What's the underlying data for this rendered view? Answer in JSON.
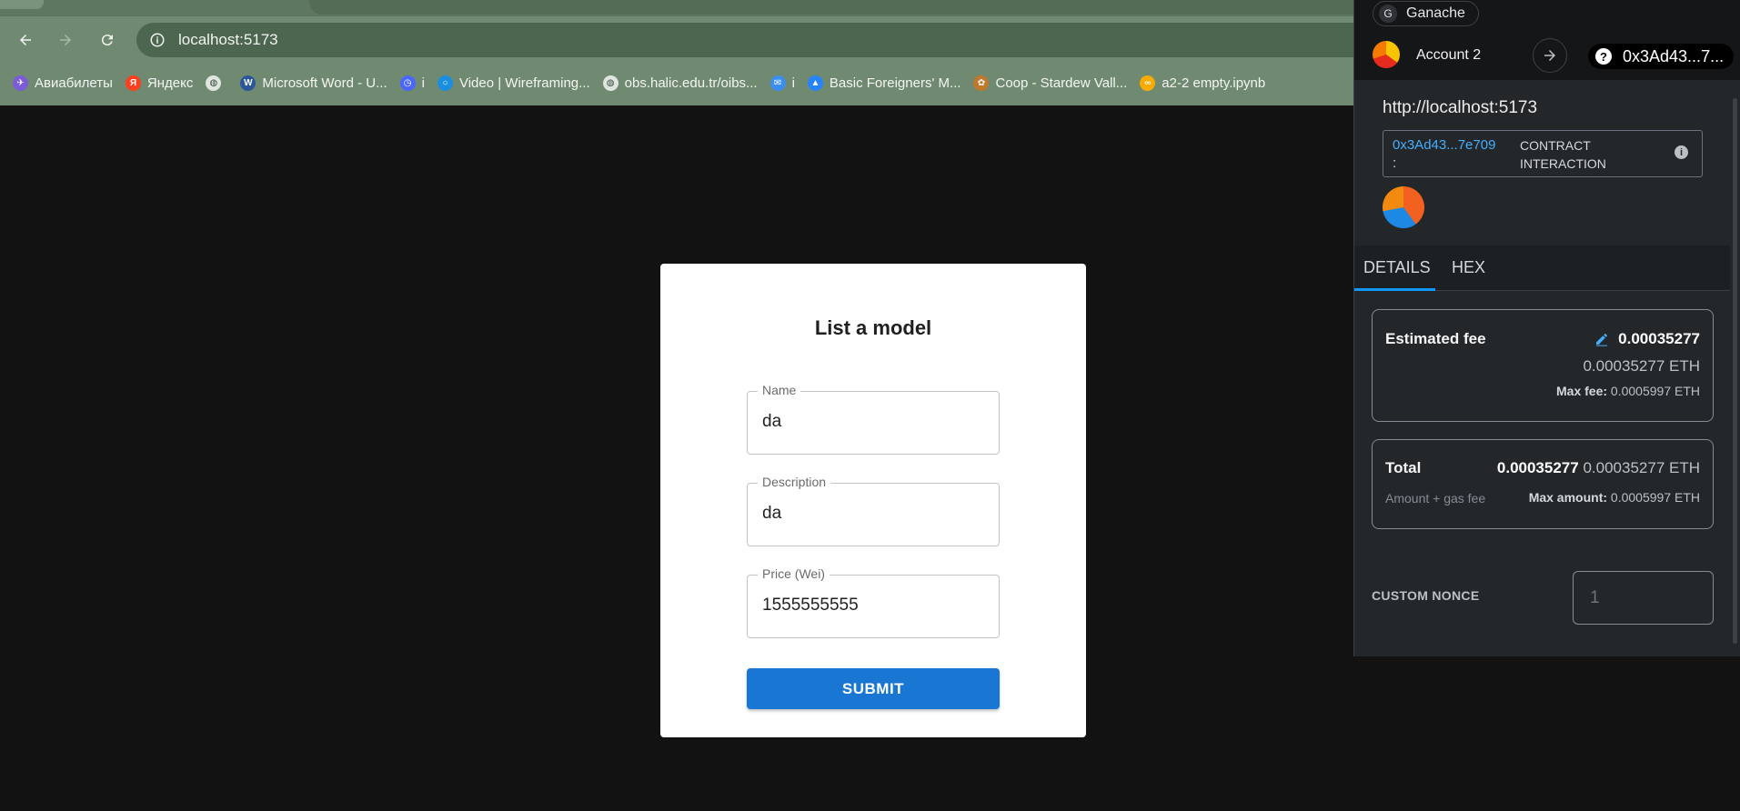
{
  "browser": {
    "url": "localhost:5173",
    "bookmarks": [
      {
        "label": "Авиабилеты",
        "icon": "airplane-globe-icon",
        "color": "#7b5cd6"
      },
      {
        "label": "Яндекс",
        "icon": "yandex-icon",
        "color": "#fc3f1d"
      },
      {
        "label": "",
        "icon": "globe-icon",
        "color": "#dfe5df"
      },
      {
        "label": "Microsoft Word - U...",
        "icon": "word-doc-icon",
        "color": "#2b579a"
      },
      {
        "label": "i",
        "icon": "time-tracker-icon",
        "color": "#4a66ff"
      },
      {
        "label": "Video | Wireframing...",
        "icon": "circle-icon",
        "color": "#1a8fe0"
      },
      {
        "label": "obs.halic.edu.tr/oibs...",
        "icon": "globe-icon",
        "color": "#dfe5df"
      },
      {
        "label": "i",
        "icon": "mail-icon",
        "color": "#3b8ef0"
      },
      {
        "label": "Basic Foreigners' M...",
        "icon": "atlassian-icon",
        "color": "#2684ff"
      },
      {
        "label": "Coop - Stardew Vall...",
        "icon": "stardew-icon",
        "color": "#c0792a"
      },
      {
        "label": "a2-2 empty.ipynb",
        "icon": "colab-icon",
        "color": "#f9ab00"
      }
    ]
  },
  "form": {
    "title": "List a model",
    "fields": [
      {
        "label": "Name",
        "value": "da"
      },
      {
        "label": "Description",
        "value": "da"
      },
      {
        "label": "Price (Wei)",
        "value": "1555555555"
      }
    ],
    "submit_label": "SUBMIT"
  },
  "metamask": {
    "network": "Ganache",
    "network_initial": "G",
    "account_name": "Account 2",
    "to_address": "0x3Ad43...7...",
    "origin": "http://localhost:5173",
    "contract_address": "0x3Ad43...7e709",
    "contract_colon": ":",
    "interaction_line1": "CONTRACT",
    "interaction_line2": "INTERACTION",
    "tabs": [
      "DETAILS",
      "HEX"
    ],
    "fee": {
      "label": "Estimated fee",
      "value": "0.00035277",
      "value_eth": "0.00035277 ETH",
      "max_label": "Max fee:",
      "max_value": "0.0005997 ETH"
    },
    "total": {
      "label": "Total",
      "value": "0.00035277",
      "value_eth": "0.00035277 ETH",
      "sub_label": "Amount + gas fee",
      "max_label": "Max amount:",
      "max_value": "0.0005997 ETH"
    },
    "nonce_label": "CUSTOM NONCE",
    "nonce_placeholder": "1"
  }
}
